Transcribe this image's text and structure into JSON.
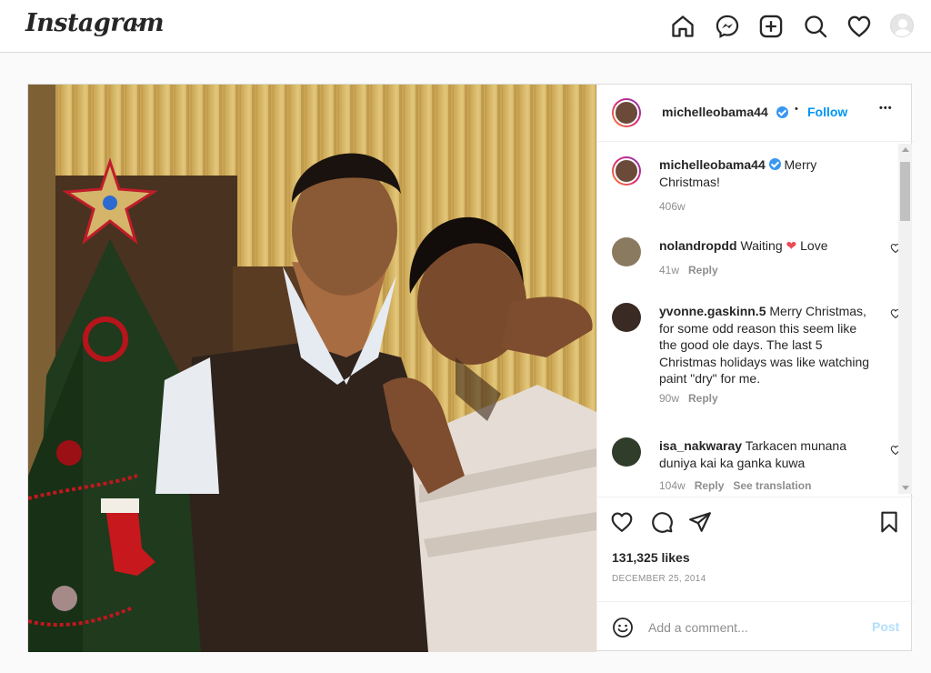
{
  "header": {
    "brand": "Instagram"
  },
  "post": {
    "author": "michelleobama44",
    "follow_label": "Follow",
    "dot": "•",
    "more": "•••",
    "comments": [
      {
        "user": "michelleobama44",
        "verified": true,
        "text": "Merry Christmas!",
        "age": "406w",
        "reply": ""
      },
      {
        "user": "nolandropdd",
        "verified": false,
        "text": "Waiting ❤ Love",
        "age": "41w",
        "reply": "Reply"
      },
      {
        "user": "yvonne.gaskinn.5",
        "verified": false,
        "text": "Merry Christmas, for some odd reason this seem like the good ole days. The last 5 Christmas holidays was like watching paint \"dry\" for me.",
        "age": "90w",
        "reply": "Reply"
      },
      {
        "user": "isa_nakwaray",
        "verified": false,
        "text": "Tarkacen munana duniya kai ka ganka kuwa",
        "age": "104w",
        "reply": "Reply",
        "translate": "See translation"
      }
    ],
    "likes": "131,325 likes",
    "date": "DECEMBER 25, 2014",
    "comment_placeholder": "Add a comment...",
    "post_label": "Post"
  },
  "icons": {
    "home": "home-icon",
    "messenger": "messenger-icon",
    "new_post": "plus-square-icon",
    "explore": "search-icon",
    "activity": "heart-icon",
    "like": "heart-icon",
    "comment": "comment-icon",
    "share": "paper-plane-icon",
    "save": "bookmark-icon",
    "emoji": "emoji-icon"
  },
  "colors": {
    "accent": "#0095f6",
    "verified": "#3897f0",
    "heart": "#ed4956"
  }
}
